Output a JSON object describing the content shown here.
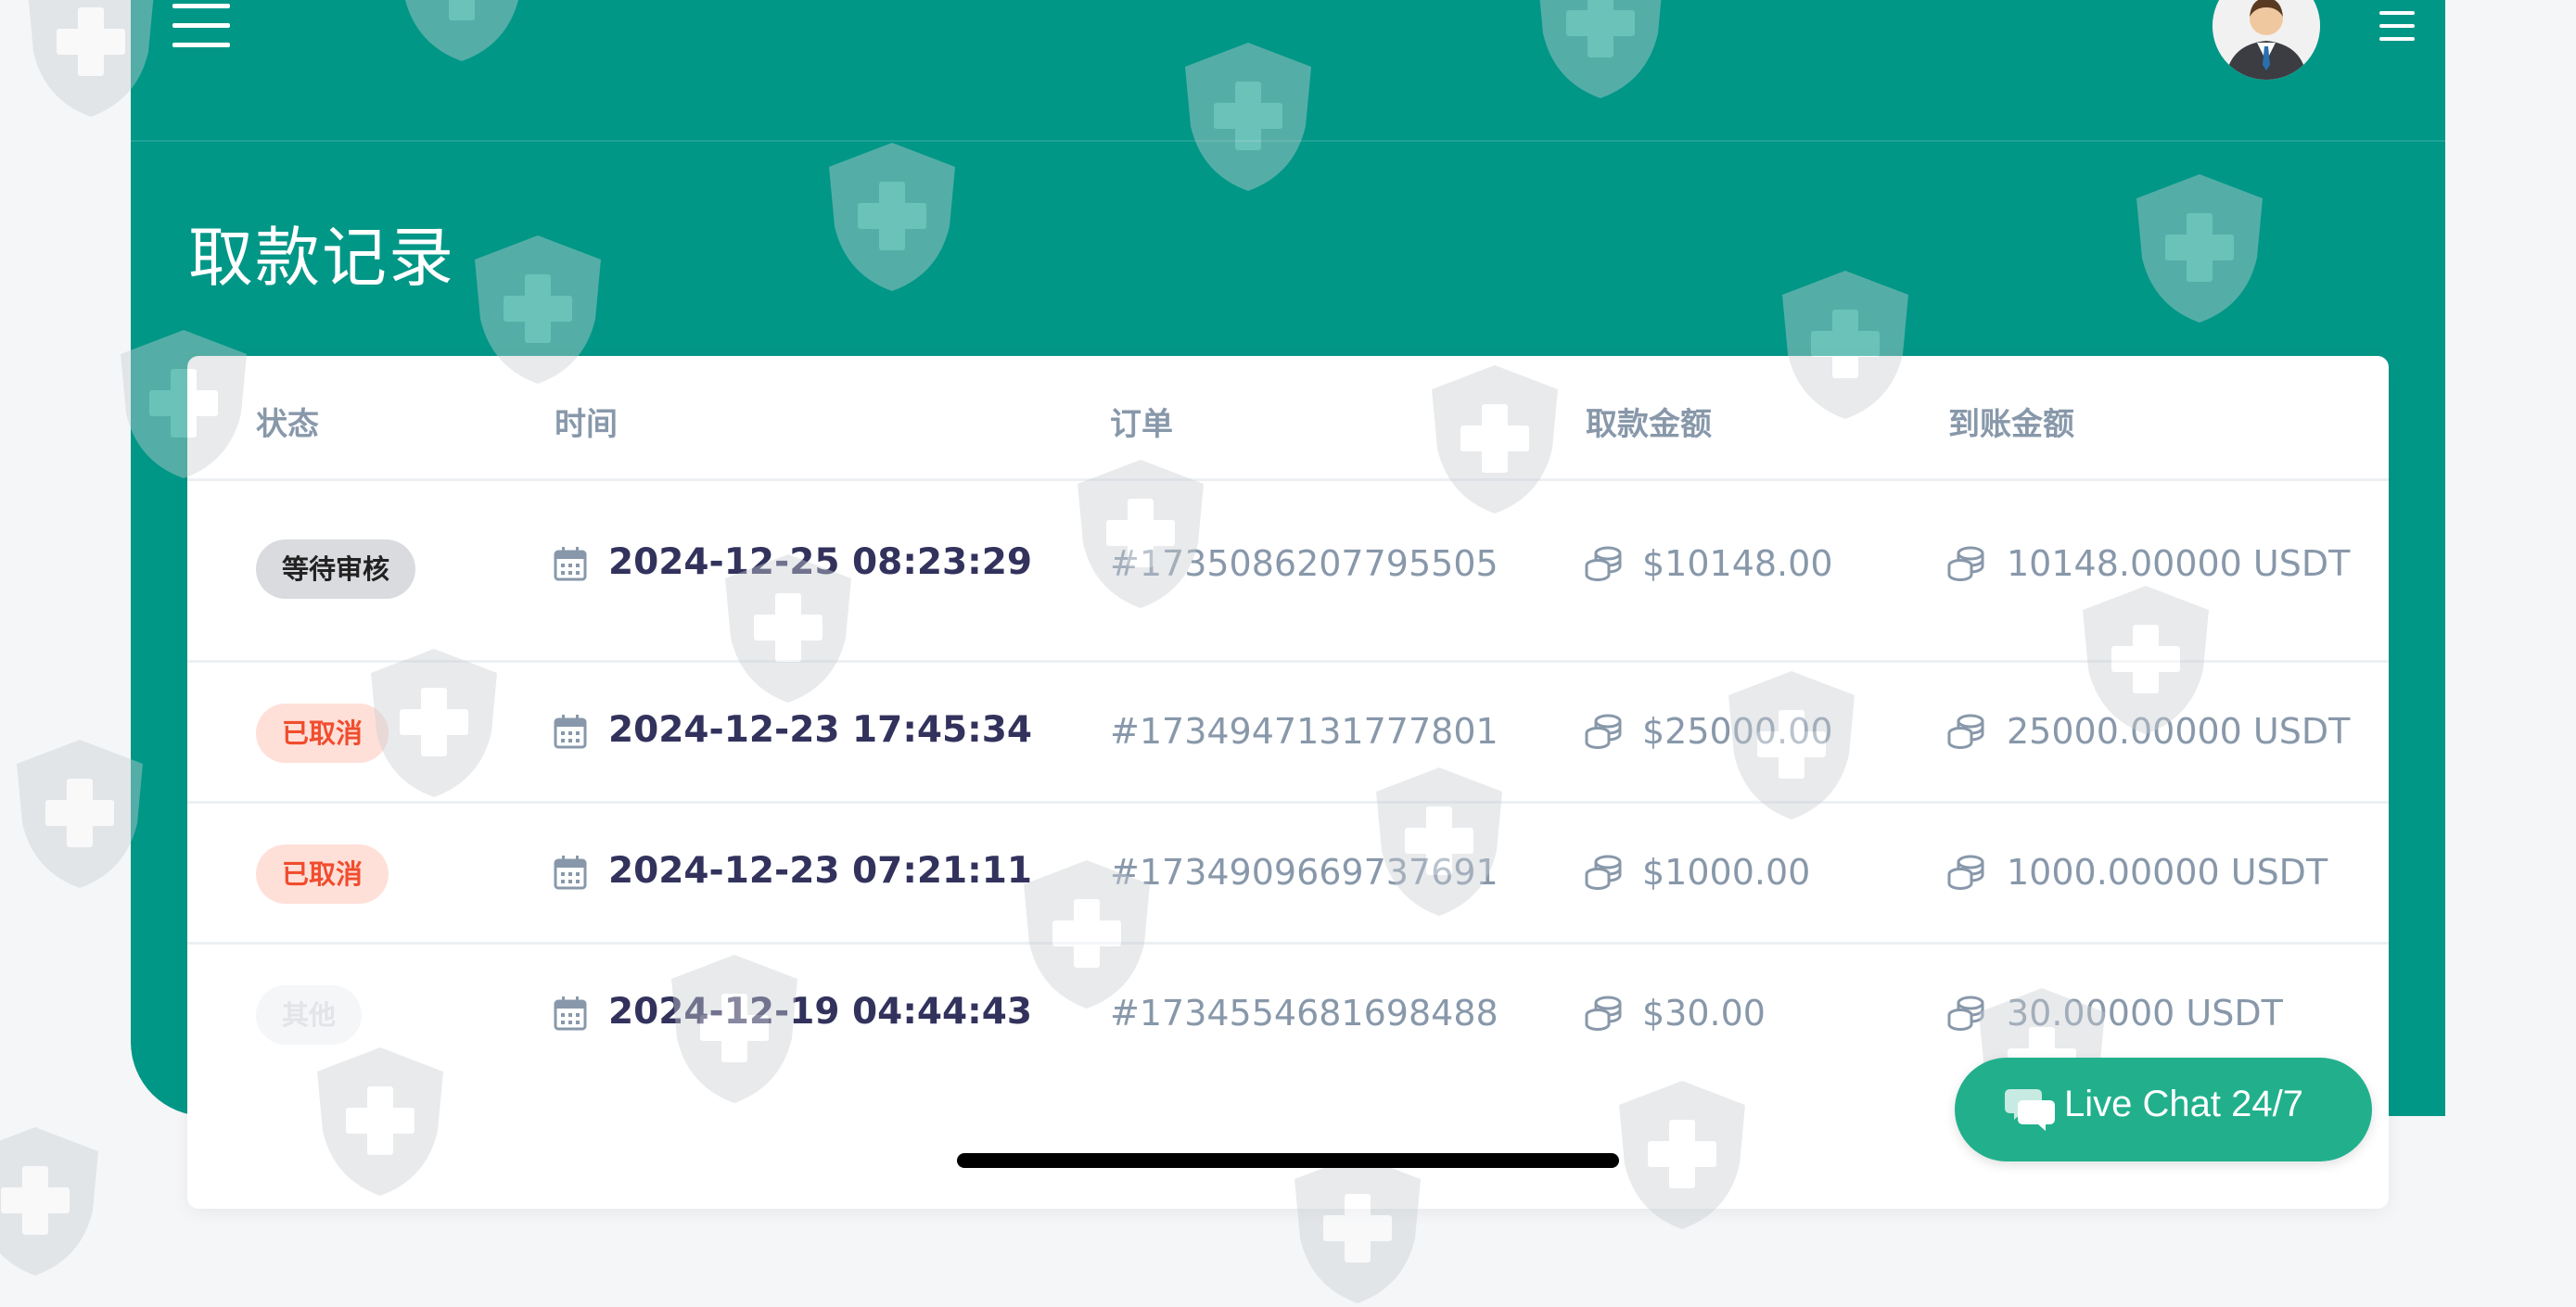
{
  "header": {
    "title": "取款记录"
  },
  "table": {
    "headers": {
      "status": "状态",
      "time": "时间",
      "order": "订单",
      "withdraw_amount": "取款金额",
      "received_amount": "到账金额"
    },
    "rows": [
      {
        "status": "等待审核",
        "status_type": "pending",
        "time": "2024-12-25 08:23:29",
        "order": "#1735086207795505",
        "withdraw_amount": "$10148.00",
        "received_amount": "10148.00000 USDT"
      },
      {
        "status": "已取消",
        "status_type": "cancelled",
        "time": "2024-12-23 17:45:34",
        "order": "#1734947131777801",
        "withdraw_amount": "$25000.00",
        "received_amount": "25000.00000 USDT"
      },
      {
        "status": "已取消",
        "status_type": "cancelled",
        "time": "2024-12-23 07:21:11",
        "order": "#1734909669737691",
        "withdraw_amount": "$1000.00",
        "received_amount": "1000.00000 USDT"
      },
      {
        "status": "其他",
        "status_type": "other",
        "time": "2024-12-19 04:44:43",
        "order": "#1734554681698488",
        "withdraw_amount": "$30.00",
        "received_amount": "30.00000 USDT"
      }
    ]
  },
  "live_chat": {
    "label": "Live Chat 24/7",
    "icon": "chat-bubbles-icon"
  },
  "colors": {
    "brand_teal": "#009787",
    "live_chat_green": "#22b08c",
    "cancel_red": "#f04d2e",
    "muted_text": "#8898aa",
    "dark_text": "#32325d"
  },
  "icons": {
    "menu": "hamburger-icon",
    "menu_right": "menu-icon",
    "calendar": "calendar-icon",
    "coins": "coin-stack-icon",
    "avatar": "user-avatar",
    "watermark": "shield-plus-icon"
  }
}
